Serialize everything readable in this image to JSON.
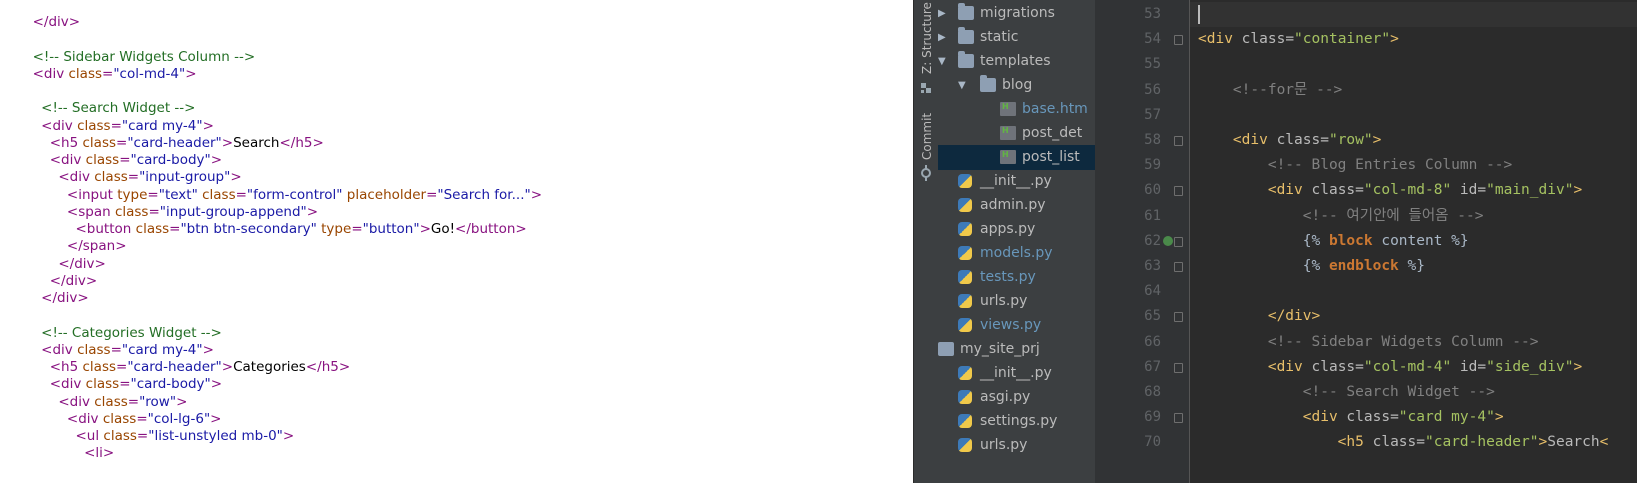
{
  "source_view": {
    "lines": [
      [
        {
          "t": "tag",
          "v": "  </div>"
        }
      ],
      [],
      [
        {
          "t": "comment",
          "v": "  <!-- Sidebar Widgets Column -->"
        }
      ],
      [
        {
          "t": "tag",
          "v": "  <div "
        },
        {
          "t": "attr",
          "v": "class"
        },
        {
          "t": "tag",
          "v": "="
        },
        {
          "t": "val",
          "v": "\"col-md-4\""
        },
        {
          "t": "tag",
          "v": ">"
        }
      ],
      [],
      [
        {
          "t": "comment",
          "v": "    <!-- Search Widget -->"
        }
      ],
      [
        {
          "t": "tag",
          "v": "    <div "
        },
        {
          "t": "attr",
          "v": "class"
        },
        {
          "t": "tag",
          "v": "="
        },
        {
          "t": "val",
          "v": "\"card my-4\""
        },
        {
          "t": "tag",
          "v": ">"
        }
      ],
      [
        {
          "t": "tag",
          "v": "      <h5 "
        },
        {
          "t": "attr",
          "v": "class"
        },
        {
          "t": "tag",
          "v": "="
        },
        {
          "t": "val",
          "v": "\"card-header\""
        },
        {
          "t": "tag",
          "v": ">"
        },
        {
          "t": "text",
          "v": "Search"
        },
        {
          "t": "tag",
          "v": "</h5>"
        }
      ],
      [
        {
          "t": "tag",
          "v": "      <div "
        },
        {
          "t": "attr",
          "v": "class"
        },
        {
          "t": "tag",
          "v": "="
        },
        {
          "t": "val",
          "v": "\"card-body\""
        },
        {
          "t": "tag",
          "v": ">"
        }
      ],
      [
        {
          "t": "tag",
          "v": "        <div "
        },
        {
          "t": "attr",
          "v": "class"
        },
        {
          "t": "tag",
          "v": "="
        },
        {
          "t": "val",
          "v": "\"input-group\""
        },
        {
          "t": "tag",
          "v": ">"
        }
      ],
      [
        {
          "t": "tag",
          "v": "          <input "
        },
        {
          "t": "attr",
          "v": "type"
        },
        {
          "t": "tag",
          "v": "="
        },
        {
          "t": "val",
          "v": "\"text\" "
        },
        {
          "t": "attr",
          "v": "class"
        },
        {
          "t": "tag",
          "v": "="
        },
        {
          "t": "val",
          "v": "\"form-control\" "
        },
        {
          "t": "attr",
          "v": "placeholder"
        },
        {
          "t": "tag",
          "v": "="
        },
        {
          "t": "val",
          "v": "\"Search for...\""
        },
        {
          "t": "tag",
          "v": ">"
        }
      ],
      [
        {
          "t": "tag",
          "v": "          <span "
        },
        {
          "t": "attr",
          "v": "class"
        },
        {
          "t": "tag",
          "v": "="
        },
        {
          "t": "val",
          "v": "\"input-group-append\""
        },
        {
          "t": "tag",
          "v": ">"
        }
      ],
      [
        {
          "t": "tag",
          "v": "            <button "
        },
        {
          "t": "attr",
          "v": "class"
        },
        {
          "t": "tag",
          "v": "="
        },
        {
          "t": "val",
          "v": "\"btn btn-secondary\" "
        },
        {
          "t": "attr",
          "v": "type"
        },
        {
          "t": "tag",
          "v": "="
        },
        {
          "t": "val",
          "v": "\"button\""
        },
        {
          "t": "tag",
          "v": ">"
        },
        {
          "t": "text",
          "v": "Go!"
        },
        {
          "t": "tag",
          "v": "</button>"
        }
      ],
      [
        {
          "t": "tag",
          "v": "          </span>"
        }
      ],
      [
        {
          "t": "tag",
          "v": "        </div>"
        }
      ],
      [
        {
          "t": "tag",
          "v": "      </div>"
        }
      ],
      [
        {
          "t": "tag",
          "v": "    </div>"
        }
      ],
      [],
      [
        {
          "t": "comment",
          "v": "    <!-- Categories Widget -->"
        }
      ],
      [
        {
          "t": "tag",
          "v": "    <div "
        },
        {
          "t": "attr",
          "v": "class"
        },
        {
          "t": "tag",
          "v": "="
        },
        {
          "t": "val",
          "v": "\"card my-4\""
        },
        {
          "t": "tag",
          "v": ">"
        }
      ],
      [
        {
          "t": "tag",
          "v": "      <h5 "
        },
        {
          "t": "attr",
          "v": "class"
        },
        {
          "t": "tag",
          "v": "="
        },
        {
          "t": "val",
          "v": "\"card-header\""
        },
        {
          "t": "tag",
          "v": ">"
        },
        {
          "t": "text",
          "v": "Categories"
        },
        {
          "t": "tag",
          "v": "</h5>"
        }
      ],
      [
        {
          "t": "tag",
          "v": "      <div "
        },
        {
          "t": "attr",
          "v": "class"
        },
        {
          "t": "tag",
          "v": "="
        },
        {
          "t": "val",
          "v": "\"card-body\""
        },
        {
          "t": "tag",
          "v": ">"
        }
      ],
      [
        {
          "t": "tag",
          "v": "        <div "
        },
        {
          "t": "attr",
          "v": "class"
        },
        {
          "t": "tag",
          "v": "="
        },
        {
          "t": "val",
          "v": "\"row\""
        },
        {
          "t": "tag",
          "v": ">"
        }
      ],
      [
        {
          "t": "tag",
          "v": "          <div "
        },
        {
          "t": "attr",
          "v": "class"
        },
        {
          "t": "tag",
          "v": "="
        },
        {
          "t": "val",
          "v": "\"col-lg-6\""
        },
        {
          "t": "tag",
          "v": ">"
        }
      ],
      [
        {
          "t": "tag",
          "v": "            <ul "
        },
        {
          "t": "attr",
          "v": "class"
        },
        {
          "t": "tag",
          "v": "="
        },
        {
          "t": "val",
          "v": "\"list-unstyled mb-0\""
        },
        {
          "t": "tag",
          "v": ">"
        }
      ],
      [
        {
          "t": "tag",
          "v": "              <li>"
        }
      ]
    ]
  },
  "tool_window_tabs": [
    "Z: Structure",
    "Commit"
  ],
  "project_tree": [
    {
      "label": "migrations",
      "kind": "folder",
      "depth": 1,
      "arrow": "right"
    },
    {
      "label": "static",
      "kind": "folder",
      "depth": 1,
      "arrow": "right"
    },
    {
      "label": "templates",
      "kind": "folder",
      "depth": 1,
      "arrow": "down"
    },
    {
      "label": "blog",
      "kind": "folder",
      "depth": 2,
      "arrow": "down"
    },
    {
      "label": "base.htm",
      "kind": "html",
      "depth": 3,
      "color": "#6897bb"
    },
    {
      "label": "post_det",
      "kind": "html",
      "depth": 3
    },
    {
      "label": "post_list",
      "kind": "html",
      "depth": 3,
      "selected": true
    },
    {
      "label": "__init__.py",
      "kind": "py",
      "depth": 1
    },
    {
      "label": "admin.py",
      "kind": "py",
      "depth": 1
    },
    {
      "label": "apps.py",
      "kind": "py",
      "depth": 1
    },
    {
      "label": "models.py",
      "kind": "py",
      "depth": 1,
      "color": "#6897bb"
    },
    {
      "label": "tests.py",
      "kind": "py",
      "depth": 1,
      "color": "#6897bb"
    },
    {
      "label": "urls.py",
      "kind": "py",
      "depth": 1
    },
    {
      "label": "views.py",
      "kind": "py",
      "depth": 1,
      "color": "#6897bb"
    },
    {
      "label": "my_site_prj",
      "kind": "project",
      "depth": 0
    },
    {
      "label": "__init__.py",
      "kind": "py",
      "depth": 1
    },
    {
      "label": "asgi.py",
      "kind": "py",
      "depth": 1
    },
    {
      "label": "settings.py",
      "kind": "py",
      "depth": 1
    },
    {
      "label": "urls.py",
      "kind": "py",
      "depth": 1
    }
  ],
  "editor": {
    "line_numbers": [
      "53",
      "54",
      "55",
      "56",
      "57",
      "58",
      "59",
      "60",
      "61",
      "62",
      "63",
      "64",
      "65",
      "66",
      "67",
      "68",
      "69",
      "70"
    ],
    "lines": [
      [],
      [
        {
          "t": "tag",
          "v": "<div "
        },
        {
          "t": "attr",
          "v": "class"
        },
        {
          "t": "attr",
          "v": "="
        },
        {
          "t": "val",
          "v": "\"container\""
        },
        {
          "t": "tag",
          "v": ">"
        }
      ],
      [],
      [
        {
          "t": "comment",
          "v": "    <!--for문 -->"
        }
      ],
      [],
      [
        {
          "t": "tag",
          "v": "    <div "
        },
        {
          "t": "attr",
          "v": "class"
        },
        {
          "t": "attr",
          "v": "="
        },
        {
          "t": "val",
          "v": "\"row\""
        },
        {
          "t": "tag",
          "v": ">"
        }
      ],
      [
        {
          "t": "comment",
          "v": "        <!-- Blog Entries Column -->"
        }
      ],
      [
        {
          "t": "tag",
          "v": "        <div "
        },
        {
          "t": "attr",
          "v": "class"
        },
        {
          "t": "attr",
          "v": "="
        },
        {
          "t": "val",
          "v": "\"col-md-8\" "
        },
        {
          "t": "attr",
          "v": "id"
        },
        {
          "t": "attr",
          "v": "="
        },
        {
          "t": "val",
          "v": "\"main_div\""
        },
        {
          "t": "tag",
          "v": ">"
        }
      ],
      [
        {
          "t": "comment",
          "v": "            <!-- 여기안에 들어옴 -->"
        }
      ],
      [
        {
          "t": "tplword",
          "v": "            {% "
        },
        {
          "t": "tpl",
          "v": "block "
        },
        {
          "t": "tplword",
          "v": "content %}"
        }
      ],
      [
        {
          "t": "tplword",
          "v": "            {% "
        },
        {
          "t": "tpl",
          "v": "endblock "
        },
        {
          "t": "tplword",
          "v": "%}"
        }
      ],
      [],
      [
        {
          "t": "tag",
          "v": "        </div>"
        }
      ],
      [
        {
          "t": "comment",
          "v": "        <!-- Sidebar Widgets Column -->"
        }
      ],
      [
        {
          "t": "tag",
          "v": "        <div "
        },
        {
          "t": "attr",
          "v": "class"
        },
        {
          "t": "attr",
          "v": "="
        },
        {
          "t": "val",
          "v": "\"col-md-4\" "
        },
        {
          "t": "attr",
          "v": "id"
        },
        {
          "t": "attr",
          "v": "="
        },
        {
          "t": "val",
          "v": "\"side_div\""
        },
        {
          "t": "tag",
          "v": ">"
        }
      ],
      [
        {
          "t": "comment",
          "v": "            <!-- Search Widget -->"
        }
      ],
      [
        {
          "t": "tag",
          "v": "            <div "
        },
        {
          "t": "attr",
          "v": "class"
        },
        {
          "t": "attr",
          "v": "="
        },
        {
          "t": "val",
          "v": "\"card my-4\""
        },
        {
          "t": "tag",
          "v": ">"
        }
      ],
      [
        {
          "t": "tag",
          "v": "                <h5 "
        },
        {
          "t": "attr",
          "v": "class"
        },
        {
          "t": "attr",
          "v": "="
        },
        {
          "t": "val",
          "v": "\"card-header\""
        },
        {
          "t": "tag",
          "v": ">"
        },
        {
          "t": "text",
          "v": "Search"
        },
        {
          "t": "tag",
          "v": "<"
        }
      ]
    ],
    "fold_lines": [
      "54",
      "58",
      "60",
      "62",
      "63",
      "65",
      "67",
      "69"
    ]
  }
}
